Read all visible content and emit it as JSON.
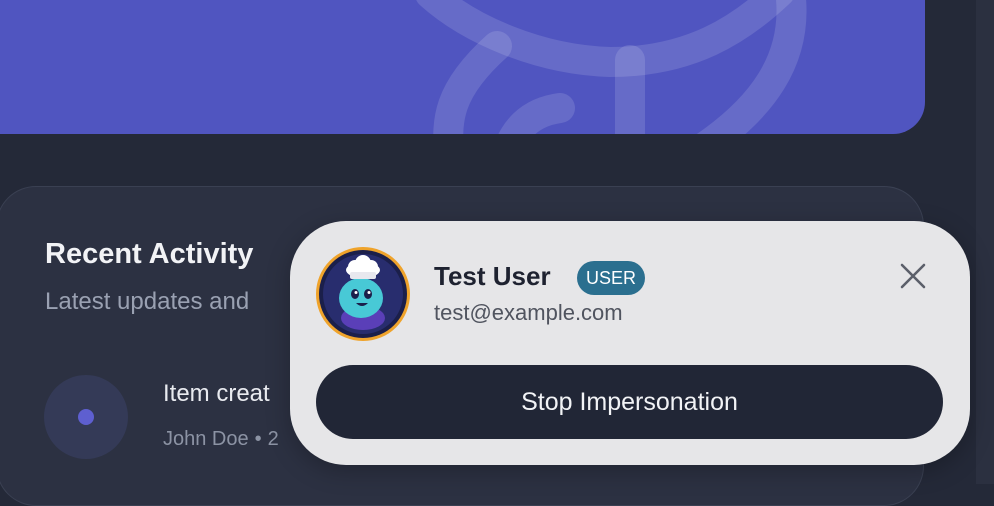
{
  "colors": {
    "background": "#242938",
    "hero": "#5055c0",
    "card": "#2c3142",
    "popup": "#e6e6e8",
    "badge": "#2b6f8f",
    "stop_button": "#212636",
    "avatar_ring": "#efa32b"
  },
  "activity": {
    "title": "Recent Activity",
    "subtitle": "Latest updates and",
    "items": [
      {
        "icon": "dot-icon",
        "title": "Item creat",
        "user": "John Doe",
        "separator": "•",
        "time": "2"
      }
    ]
  },
  "impersonation": {
    "avatar_icon": "chef-mascot-avatar",
    "name": "Test User",
    "role_badge": "USER",
    "email": "test@example.com",
    "close_icon": "close-icon",
    "stop_label": "Stop Impersonation"
  }
}
